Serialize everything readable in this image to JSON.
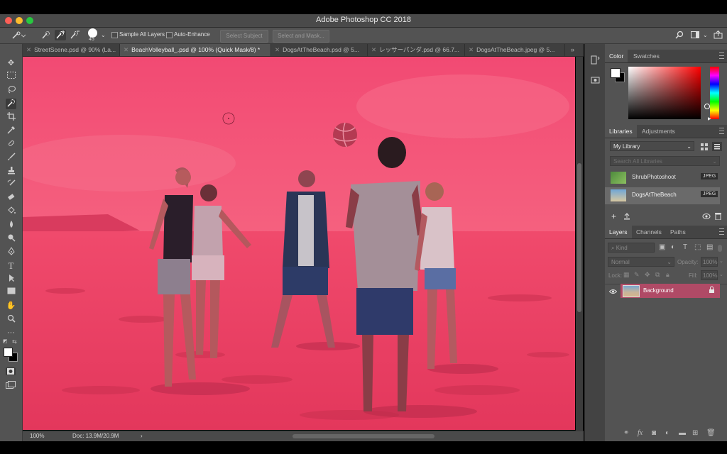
{
  "window": {
    "title": "Adobe Photoshop CC 2018"
  },
  "options_bar": {
    "brush_size": "45",
    "sample_all_layers_label": "Sample All Layers",
    "auto_enhance_label": "Auto-Enhance",
    "select_subject_label": "Select Subject",
    "select_and_mask_label": "Select and Mask..."
  },
  "tabs": [
    {
      "label": "StreetScene.psd @ 90% (La..."
    },
    {
      "label": "BeachVolleyball_.psd @ 100% (Quick Mask/8) *"
    },
    {
      "label": "DogsAtTheBeach.psd @ 5..."
    },
    {
      "label": "レッサーパンダ.psd @ 66.7..."
    },
    {
      "label": "DogsAtTheBeach.jpeg @ 5..."
    }
  ],
  "status_bar": {
    "zoom": "100%",
    "doc_size": "Doc: 13.9M/20.9M"
  },
  "color_panel": {
    "tabs": [
      "Color",
      "Swatches"
    ],
    "foreground": "#ffffff",
    "background": "#000000",
    "hue_color": "#ff0000"
  },
  "libraries_panel": {
    "tabs": [
      "Libraries",
      "Adjustments"
    ],
    "library_name": "My Library",
    "search_placeholder": "Search All Libraries",
    "items": [
      {
        "name": "ShrubPhotoshoot",
        "type": "JPEG"
      },
      {
        "name": "DogsAtTheBeach",
        "type": "JPEG"
      }
    ]
  },
  "layers_panel": {
    "tabs": [
      "Layers",
      "Channels",
      "Paths"
    ],
    "filter_kind": "Kind",
    "blend_mode": "Normal",
    "opacity_label": "Opacity:",
    "opacity_value": "100%",
    "lock_label": "Lock:",
    "fill_label": "Fill:",
    "fill_value": "100%",
    "layers": [
      {
        "name": "Background",
        "locked": true,
        "visible": true
      }
    ]
  },
  "colors": {
    "quick_mask_overlay": "#ff3c64",
    "active_layer": "#b04a66"
  }
}
